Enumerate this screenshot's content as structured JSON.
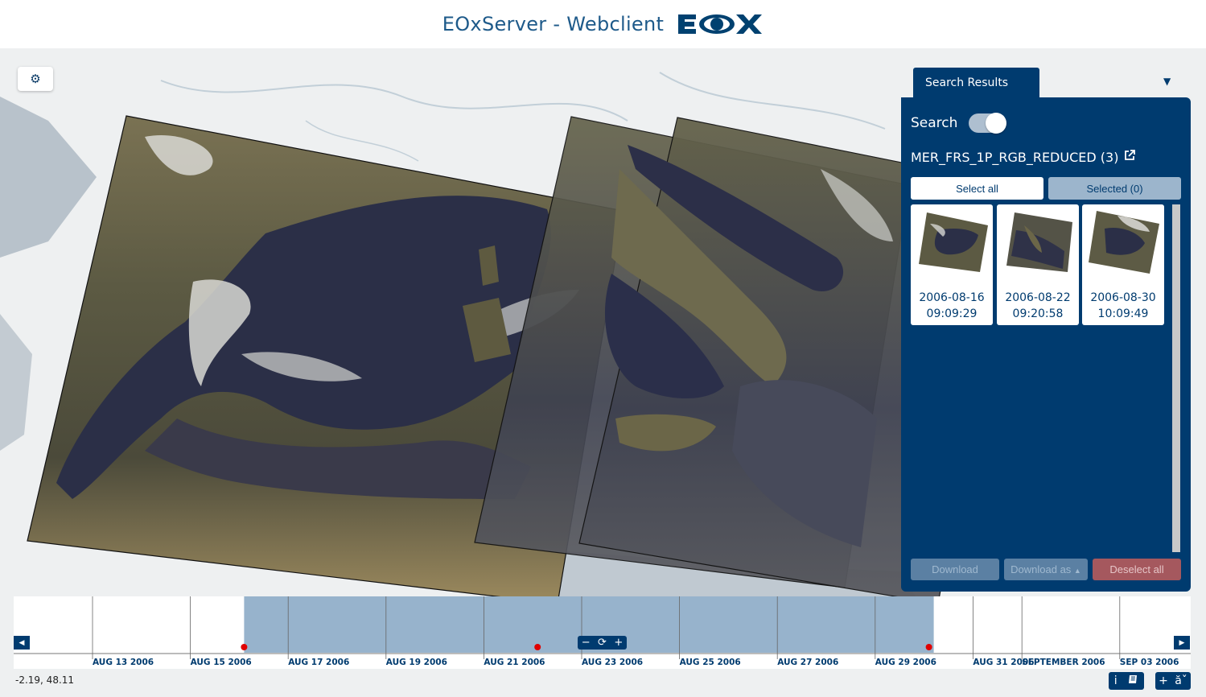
{
  "header": {
    "title": "EOxServer - Webclient",
    "logo_text": "EOX"
  },
  "map": {
    "settings_icon": "gear-icon",
    "coordinates": "-2.19, 48.11"
  },
  "search_panel": {
    "tab_label": "Search Results",
    "search_label": "Search",
    "search_enabled": true,
    "collection_name": "MER_FRS_1P_RGB_REDUCED (3)",
    "collection_link_icon": "external-link-icon",
    "select_all_label": "Select all",
    "selected_label": "Selected (0)",
    "results": [
      {
        "date": "2006-08-16",
        "time": "09:09:29"
      },
      {
        "date": "2006-08-22",
        "time": "09:20:58"
      },
      {
        "date": "2006-08-30",
        "time": "10:09:49"
      }
    ],
    "download_label": "Download",
    "download_as_label": "Download as",
    "deselect_all_label": "Deselect all"
  },
  "timeline": {
    "ticks": [
      {
        "date": "2006-08-13",
        "label": "AUG 13 2006"
      },
      {
        "date": "2006-08-15",
        "label": "AUG 15 2006"
      },
      {
        "date": "2006-08-17",
        "label": "AUG 17 2006"
      },
      {
        "date": "2006-08-19",
        "label": "AUG 19 2006"
      },
      {
        "date": "2006-08-21",
        "label": "AUG 21 2006"
      },
      {
        "date": "2006-08-23",
        "label": "AUG 23 2006"
      },
      {
        "date": "2006-08-25",
        "label": "AUG 25 2006"
      },
      {
        "date": "2006-08-27",
        "label": "AUG 27 2006"
      },
      {
        "date": "2006-08-29",
        "label": "AUG 29 2006"
      },
      {
        "date": "2006-08-31",
        "label": "AUG 31 2006"
      },
      {
        "date": "2006-09-01",
        "label": "SEPTEMBER 2006"
      },
      {
        "date": "2006-09-03",
        "label": "SEP 03 2006"
      }
    ],
    "selection": {
      "start": "2006-08-16",
      "end": "2006-08-30"
    },
    "events": [
      "2006-08-16",
      "2006-08-22",
      "2006-08-30"
    ],
    "selection_color": "#97b3cc",
    "event_color": "#e00000"
  },
  "bottom_buttons": {
    "info_label": "i",
    "book_icon": "book-icon",
    "plus_label": "+",
    "lang_label": "ăˇ"
  }
}
